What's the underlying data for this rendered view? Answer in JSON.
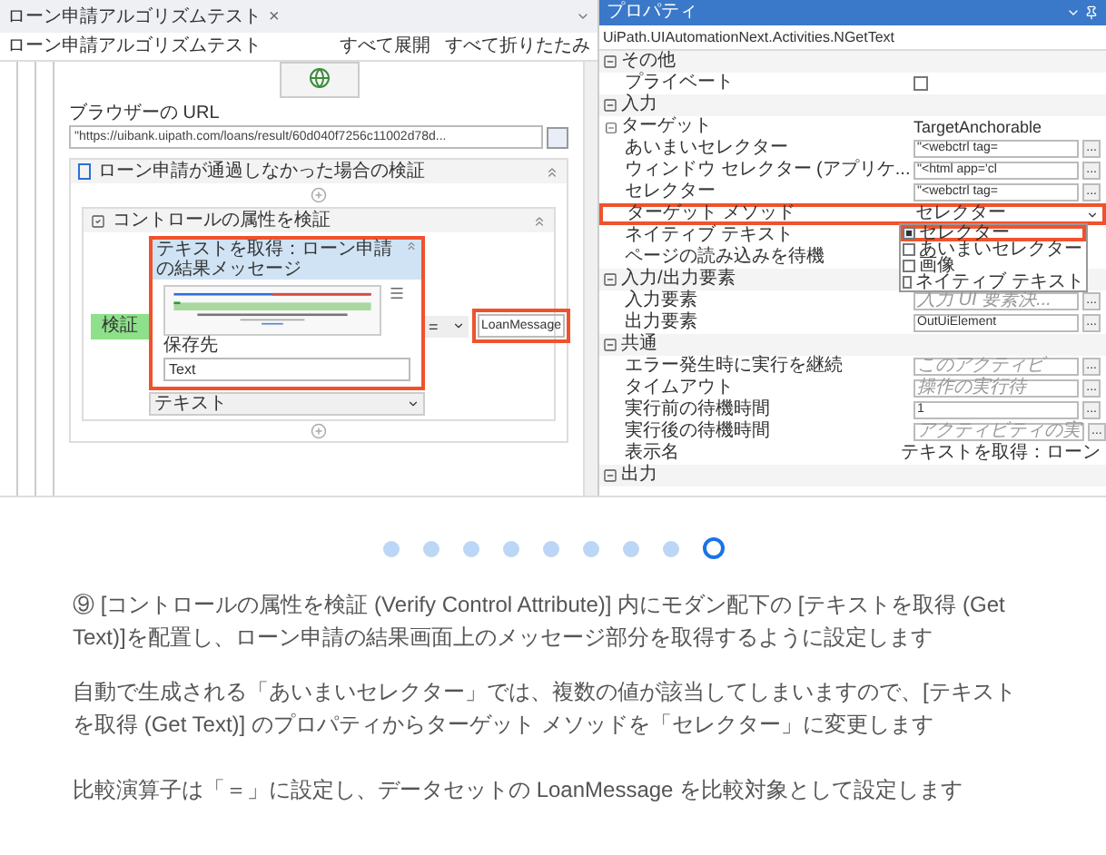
{
  "editor": {
    "tab": {
      "title": "ローン申請アルゴリズムテスト",
      "close": "×"
    },
    "breadcrumb": "ローン申請アルゴリズムテスト",
    "expand_all": "すべて展開",
    "collapse_all": "すべて折りたたみ",
    "browser_url_label": "ブラウザーの URL",
    "browser_url": "\"https://uibank.uipath.com/loans/result/60d040f7256c11002d78d...",
    "sequence_title": "ローン申請が通過しなかった場合の検証",
    "verify_title": "コントロールの属性を検証",
    "get_text": {
      "title": "テキストを取得：ローン申請の結果メッセージ",
      "save_to_label": "保存先",
      "save_to": "Text",
      "highlighted": true
    },
    "attribute": "テキスト",
    "verify_label": "検証",
    "operator": "=",
    "expected": {
      "value": "LoanMessage",
      "highlighted": true
    }
  },
  "properties": {
    "title": "プロパティ",
    "activity": "UiPath.UIAutomationNext.Activities.NGetText",
    "rows": [
      {
        "kind": "category",
        "label": "その他"
      },
      {
        "kind": "checkbox",
        "label": "プライベート",
        "checked": false
      },
      {
        "kind": "category",
        "label": "入力"
      },
      {
        "kind": "group",
        "label": "ターゲット",
        "value": "TargetAnchorable"
      },
      {
        "kind": "field",
        "label": "あいまいセレクター",
        "value": "\"<webctrl tag=",
        "more": "..."
      },
      {
        "kind": "field",
        "label": "ウィンドウ セレクター (アプリケ...",
        "value": "\"<html app='cl",
        "more": "..."
      },
      {
        "kind": "field",
        "label": "セレクター",
        "value": "\"<webctrl tag=",
        "more": "..."
      },
      {
        "kind": "dropdown",
        "label": "ターゲット メソッド",
        "value": "セレクター",
        "highlighted": true,
        "options": [
          {
            "label": "セレクター",
            "checked": true,
            "highlighted": true
          },
          {
            "label": "あいまいセレクター",
            "checked": false,
            "highlighted": false
          },
          {
            "label": "画像",
            "checked": false,
            "highlighted": false
          },
          {
            "label": "ネイティブ テキスト",
            "checked": false,
            "highlighted": false
          }
        ]
      },
      {
        "kind": "plain",
        "label": "ネイティブ テキスト"
      },
      {
        "kind": "plain",
        "label": "ページの読み込みを待機"
      },
      {
        "kind": "category",
        "label": "入力/出力要素"
      },
      {
        "kind": "field",
        "label": "入力要素",
        "placeholder": "入力 UI 要素決...",
        "more": "..."
      },
      {
        "kind": "field",
        "label": "出力要素",
        "value": "OutUiElement",
        "more": "..."
      },
      {
        "kind": "category",
        "label": "共通"
      },
      {
        "kind": "field",
        "label": "エラー発生時に実行を継続",
        "placeholder": "このアクティビ",
        "more": "..."
      },
      {
        "kind": "field",
        "label": "タイムアウト",
        "placeholder": "操作の実行待",
        "more": "..."
      },
      {
        "kind": "field",
        "label": "実行前の待機時間",
        "value": "1",
        "more": "..."
      },
      {
        "kind": "field",
        "label": "実行後の待機時間",
        "placeholder": "アクティビティの実",
        "more": "..."
      },
      {
        "kind": "text",
        "label": "表示名",
        "value": "テキストを取得：ローン"
      },
      {
        "kind": "category",
        "label": "出力"
      }
    ]
  },
  "carousel": [
    {
      "selected": false
    },
    {
      "selected": false
    },
    {
      "selected": false
    },
    {
      "selected": false
    },
    {
      "selected": false
    },
    {
      "selected": false
    },
    {
      "selected": false
    },
    {
      "selected": false
    },
    {
      "selected": true
    }
  ],
  "paragraphs": [
    "⑨ [コントロールの属性を検証 (Verify Control Attribute)] 内にモダン配下の [テキストを取得 (Get Text)]を配置し、ローン申請の結果画面上のメッセージ部分を取得するように設定します",
    "自動で生成される「あいまいセレクター」では、複数の値が該当してしまいますので、[テキストを取得 (Get Text)] のプロパティからターゲット メソッドを「セレクター」に変更します",
    "比較演算子は「＝」に設定し、データセットの LoanMessage を比較対象として設定します"
  ]
}
